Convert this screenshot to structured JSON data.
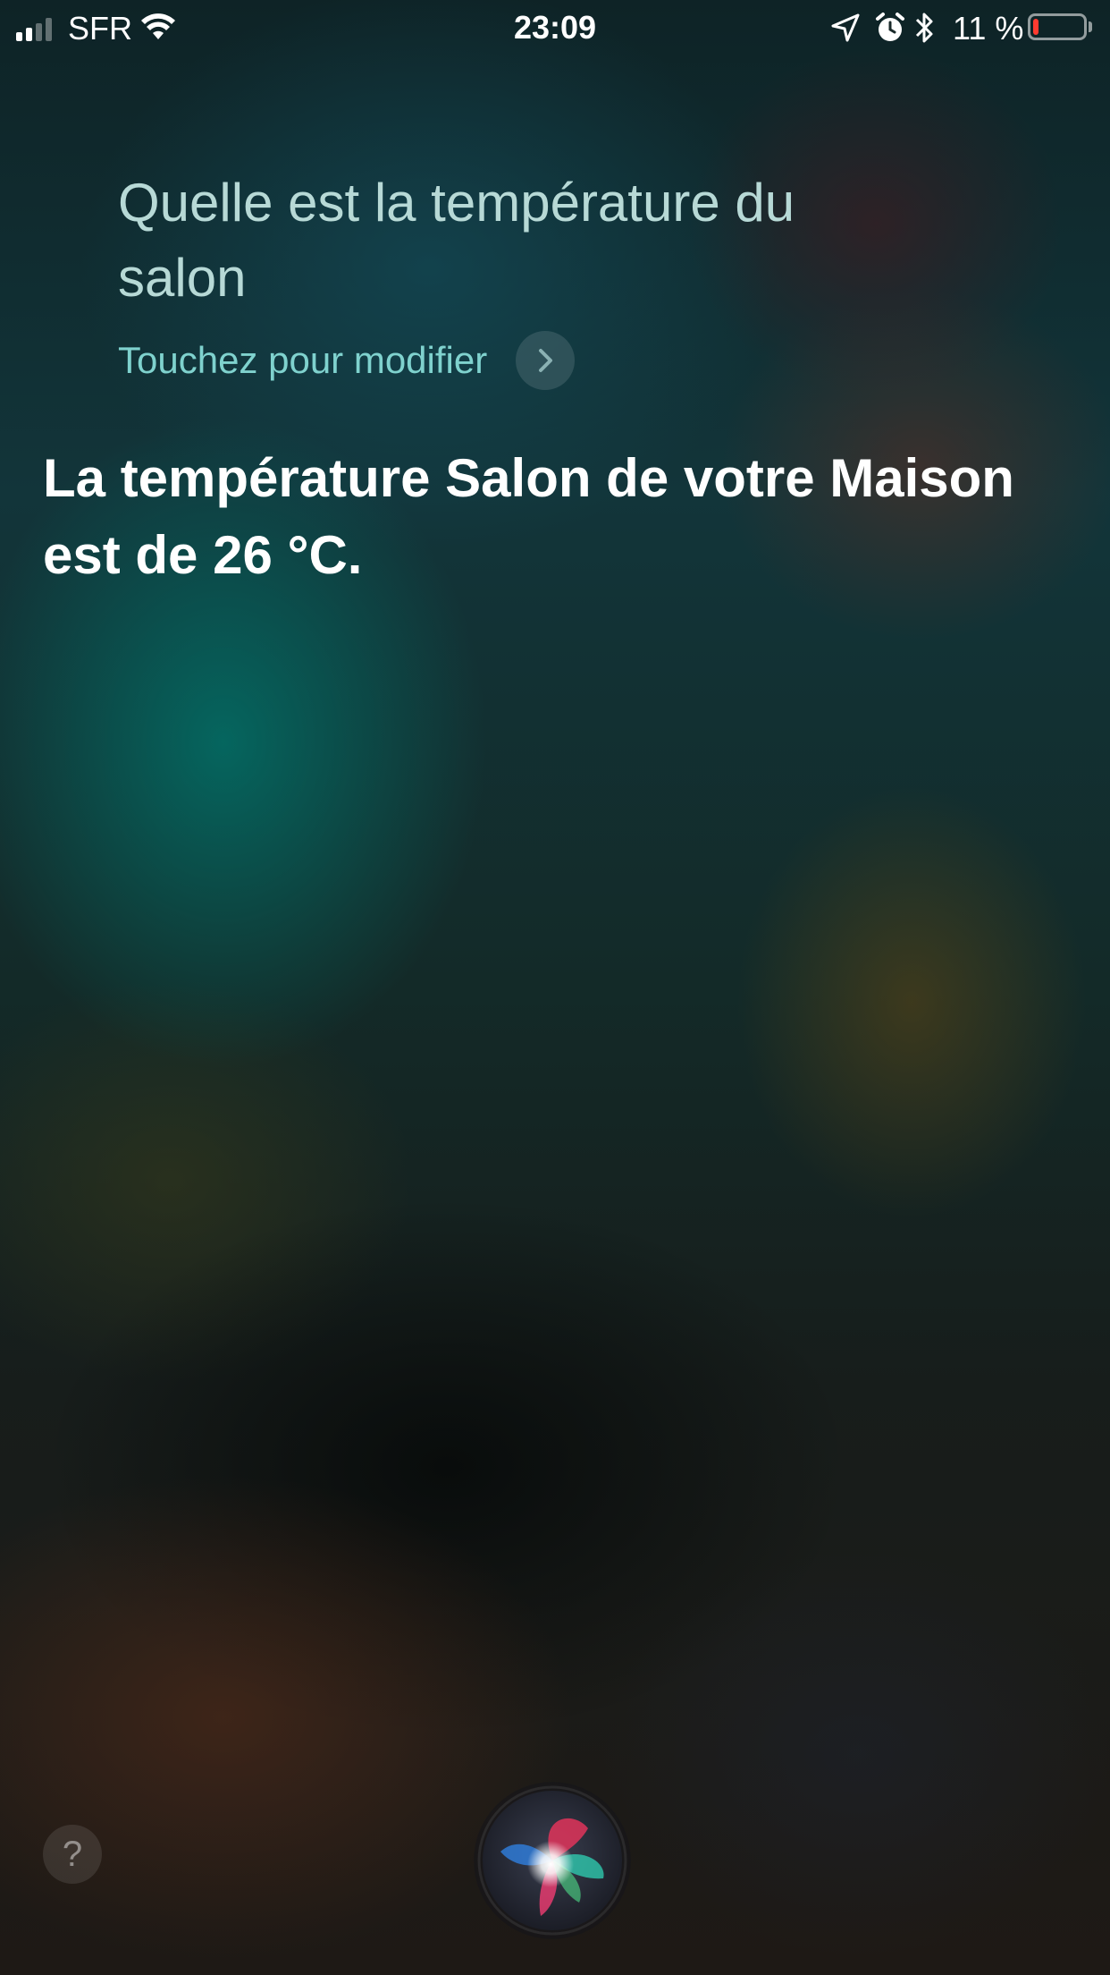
{
  "status_bar": {
    "carrier": "SFR",
    "time": "23:09",
    "battery_percent_label": "11 %",
    "battery_level": 0.11,
    "battery_color": "#ff3b30",
    "icons": [
      "signal-icon",
      "wifi-icon",
      "location-icon",
      "alarm-icon",
      "bluetooth-icon",
      "battery-icon"
    ]
  },
  "siri": {
    "query": "Quelle est la température du salon",
    "edit_label": "Touchez pour modifier",
    "answer": "La température Salon de votre Maison est de 26 °C.",
    "query_color": "#b7d9d6",
    "edit_color": "#7fd2ce"
  },
  "controls": {
    "help_label": "?",
    "help_icon": "question-icon",
    "siri_icon": "siri-orb-icon"
  }
}
